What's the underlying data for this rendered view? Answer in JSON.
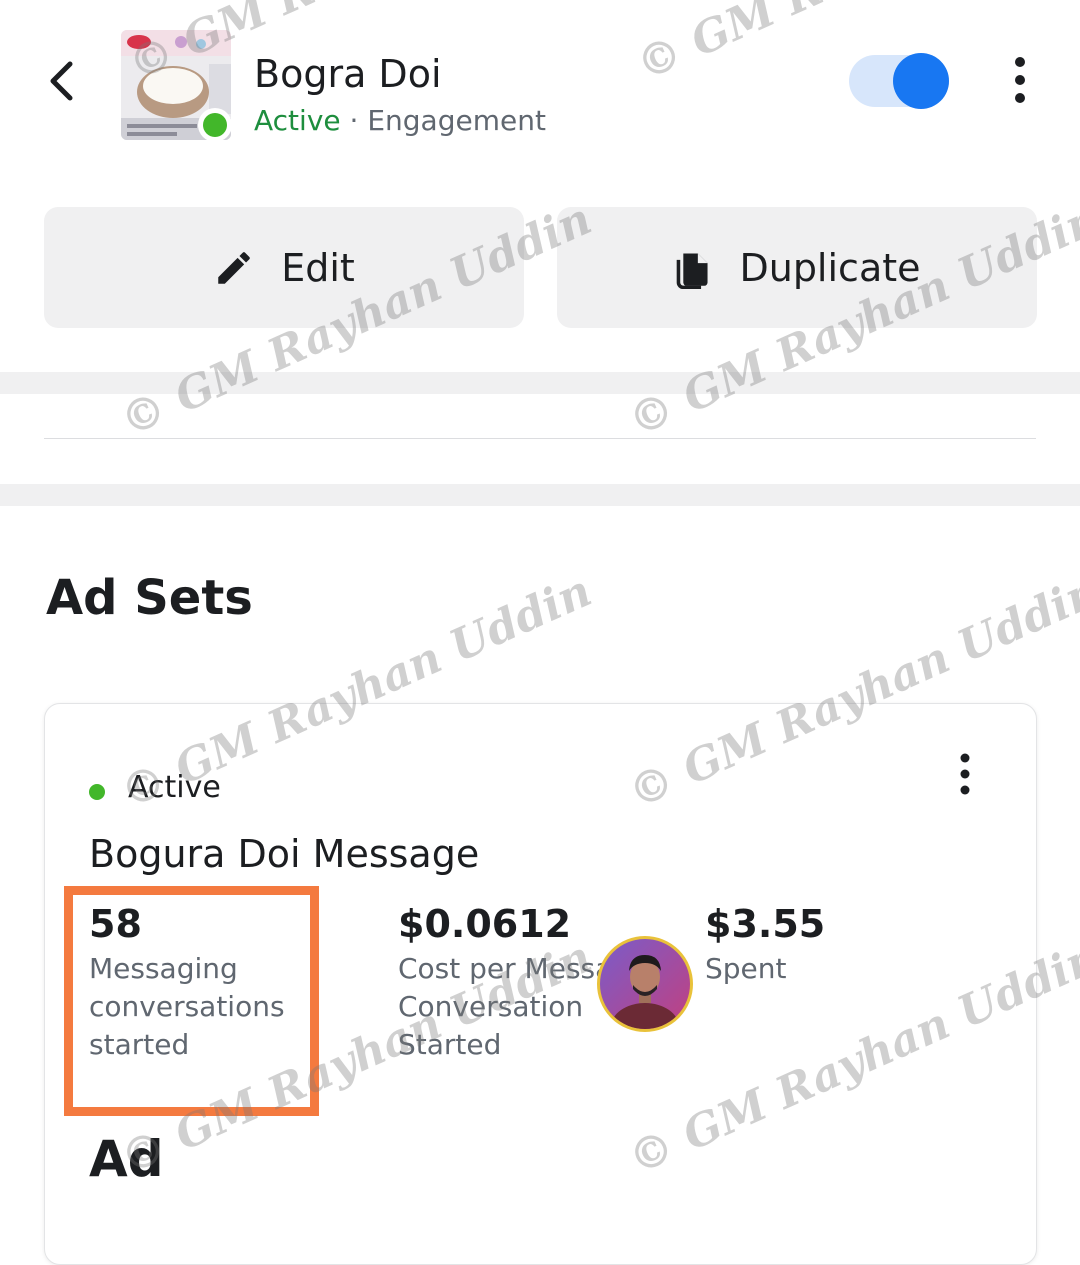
{
  "header": {
    "title": "Bogra Doi",
    "status": "Active",
    "separator": "·",
    "objective": "Engagement"
  },
  "actions": {
    "edit_label": "Edit",
    "duplicate_label": "Duplicate"
  },
  "section": {
    "title": "Ad Sets"
  },
  "ad_set": {
    "status": "Active",
    "name": "Bogura Doi Message",
    "metrics": [
      {
        "value": "58",
        "label": "Messaging conversations started"
      },
      {
        "value": "$0.0612",
        "label": "Cost per Messa Conversation Started"
      },
      {
        "value": "$3.55",
        "label": "Spent"
      }
    ]
  },
  "ads": {
    "title": "Ad"
  },
  "watermark": "© GM Rayhan Uddin",
  "colors": {
    "active_green": "#42b72a",
    "toggle_blue": "#1877f2",
    "highlight_orange": "#f47a3f"
  },
  "icons": [
    "back-arrow-icon",
    "more-vertical-icon",
    "pencil-icon",
    "duplicate-icon"
  ]
}
